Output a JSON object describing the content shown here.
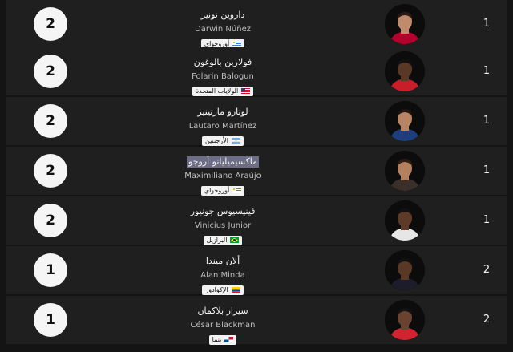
{
  "players": [
    {
      "rank": "1",
      "name_ar": "داروين نونيز",
      "name_en": "Darwin Núñez",
      "country": "أوروجواي",
      "country_icon": "flag-uruguay-icon",
      "value": "2",
      "skin": "#c08a6c",
      "hair": "#2a1c14",
      "shirt": "#b3002d"
    },
    {
      "rank": "1",
      "name_ar": "فولارين بالوغون",
      "name_en": "Folarin Balogun",
      "country": "الولايات المتحدة",
      "country_icon": "flag-usa-icon",
      "value": "2",
      "skin": "#5a3826",
      "hair": "#151010",
      "shirt": "#c81e2a"
    },
    {
      "rank": "1",
      "name_ar": "لوتارو مارتينيز",
      "name_en": "Lautaro Martínez",
      "country": "الأرجنتين",
      "country_icon": "flag-argentina-icon",
      "value": "2",
      "skin": "#b78566",
      "hair": "#1d140f",
      "shirt": "#1d3f7d"
    },
    {
      "rank": "1",
      "name_ar": "ماكسيميليانو أروجو",
      "name_en": "Maximiliano Araújo",
      "country": "أوروجواي",
      "country_icon": "flag-uruguay-icon",
      "value": "2",
      "skin": "#b47f5f",
      "hair": "#2a1c14",
      "shirt": "#3a2f2a"
    },
    {
      "rank": "1",
      "name_ar": "فينيسيوس جونيور",
      "name_en": "Vinicius Junior",
      "country": "البرازيل",
      "country_icon": "flag-brazil-icon",
      "value": "2",
      "skin": "#5e3b28",
      "hair": "#111111",
      "shirt": "#e6e6e6"
    },
    {
      "rank": "2",
      "name_ar": "ألان ميندا",
      "name_en": "Alan Minda",
      "country": "الإكوادور",
      "country_icon": "flag-ecuador-icon",
      "value": "1",
      "skin": "#5a3826",
      "hair": "#151010",
      "shirt": "#1c1c2a"
    },
    {
      "rank": "2",
      "name_ar": "سيزار بلاكمان",
      "name_en": "César Blackman",
      "country": "بنما",
      "country_icon": "flag-panama-icon",
      "value": "1",
      "skin": "#6a4330",
      "hair": "#121212",
      "shirt": "#d12430"
    }
  ],
  "highlighted_index": 3
}
